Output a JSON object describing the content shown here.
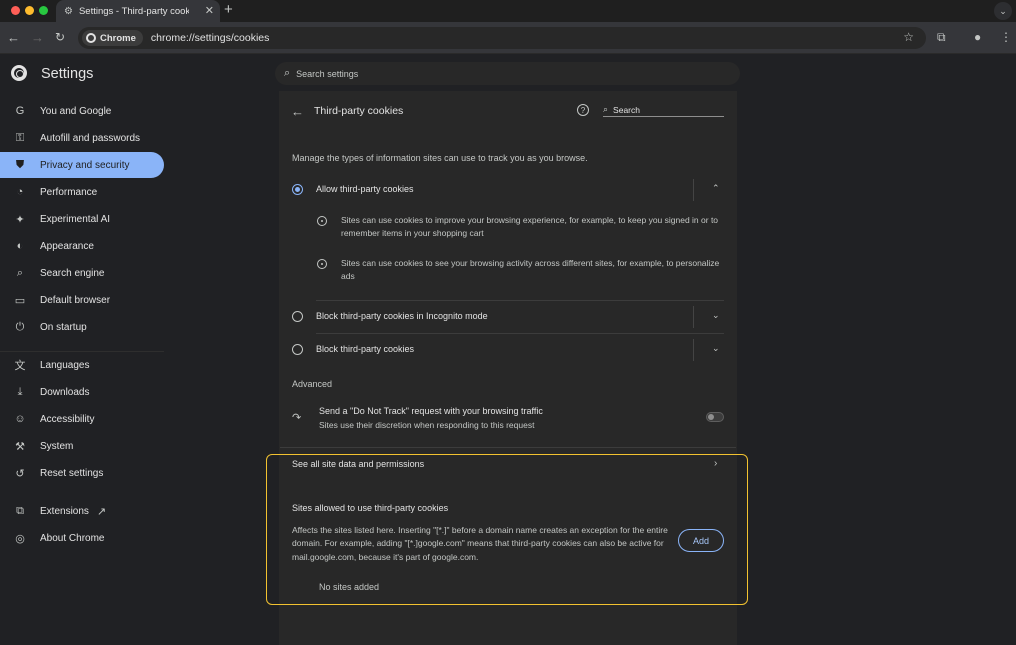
{
  "window": {
    "tab_title": "Settings - Third-party cookies",
    "tab_close": "✕",
    "new_tab": "+",
    "tab_menu": "⌄"
  },
  "toolbar": {
    "chip_label": "Chrome",
    "url": "chrome://settings/cookies"
  },
  "settings": {
    "title": "Settings",
    "search_placeholder": "Search settings"
  },
  "sidebar": {
    "items": [
      {
        "label": "You and Google",
        "icon": "G"
      },
      {
        "label": "Autofill and passwords",
        "icon": "⚿"
      },
      {
        "label": "Privacy and security",
        "icon": "⛊"
      },
      {
        "label": "Performance",
        "icon": "◔"
      },
      {
        "label": "Experimental AI",
        "icon": "✦"
      },
      {
        "label": "Appearance",
        "icon": "◐"
      },
      {
        "label": "Search engine",
        "icon": "⌕"
      },
      {
        "label": "Default browser",
        "icon": "▭"
      },
      {
        "label": "On startup",
        "icon": "⏻"
      },
      {
        "label": "Languages",
        "icon": "文"
      },
      {
        "label": "Downloads",
        "icon": "⤓"
      },
      {
        "label": "Accessibility",
        "icon": "☺"
      },
      {
        "label": "System",
        "icon": "⚒"
      },
      {
        "label": "Reset settings",
        "icon": "↺"
      },
      {
        "label": "Extensions",
        "icon": "⧉"
      },
      {
        "label": "About Chrome",
        "icon": "◎"
      }
    ]
  },
  "page": {
    "title": "Third-party cookies",
    "search_placeholder": "Search",
    "intro": "Manage the types of information sites can use to track you as you browse.",
    "options": [
      {
        "label": "Allow third-party cookies",
        "selected": true
      },
      {
        "label": "Block third-party cookies in Incognito mode",
        "selected": false
      },
      {
        "label": "Block third-party cookies",
        "selected": false
      }
    ],
    "details": [
      "Sites can use cookies to improve your browsing experience, for example, to keep you signed in or to remember items in your shopping cart",
      "Sites can use cookies to see your browsing activity across different sites, for example, to personalize ads"
    ],
    "advanced_heading": "Advanced",
    "dnt_title": "Send a \"Do Not Track\" request with your browsing traffic",
    "dnt_subtitle": "Sites use their discretion when responding to this request",
    "dnt_enabled": false,
    "site_data_link": "See all site data and permissions",
    "allowed_title": "Sites allowed to use third-party cookies",
    "allowed_desc": "Affects the sites listed here. Inserting \"[*.]\" before a domain name creates an exception for the entire domain. For example, adding \"[*.]google.com\" means that third-party cookies can also be active for mail.google.com, because it's part of google.com.",
    "add_label": "Add",
    "no_sites": "No sites added"
  },
  "colors": {
    "accent": "#8ab4f8",
    "highlight": "#f2c230"
  }
}
